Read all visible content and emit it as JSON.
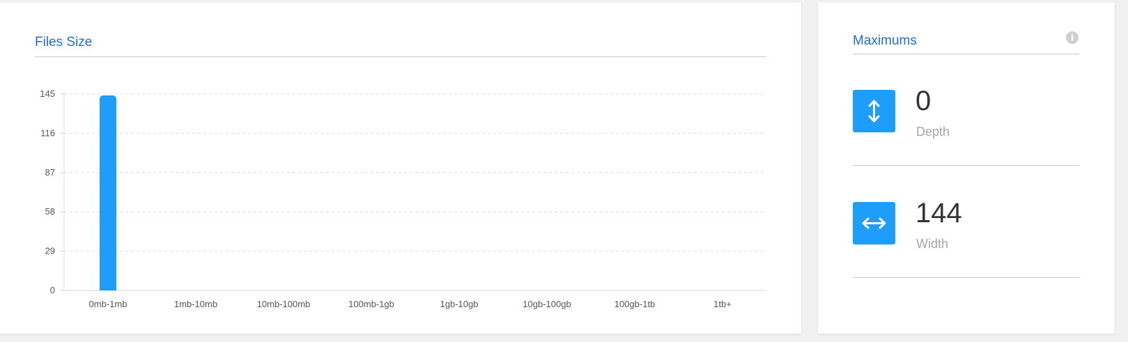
{
  "files_size": {
    "title": "Files Size"
  },
  "chart_data": {
    "type": "bar",
    "title": "Files Size",
    "xlabel": "",
    "ylabel": "",
    "categories": [
      "0mb-1mb",
      "1mb-10mb",
      "10mb-100mb",
      "100mb-1gb",
      "1gb-10gb",
      "10gb-100gb",
      "100gb-1tb",
      "1tb+"
    ],
    "values": [
      144,
      0,
      0,
      0,
      0,
      0,
      0,
      0
    ],
    "yticks": [
      0,
      29,
      58,
      87,
      116,
      145
    ],
    "ylim": [
      0,
      145
    ],
    "grid": true,
    "color": "#1f9dfb"
  },
  "maximums": {
    "title": "Maximums",
    "info_icon": "info-icon",
    "depth": {
      "value": "0",
      "label": "Depth",
      "icon": "vertical-arrows-icon"
    },
    "width": {
      "value": "144",
      "label": "Width",
      "icon": "horizontal-arrows-icon"
    },
    "accent": "#1f9dfb"
  }
}
